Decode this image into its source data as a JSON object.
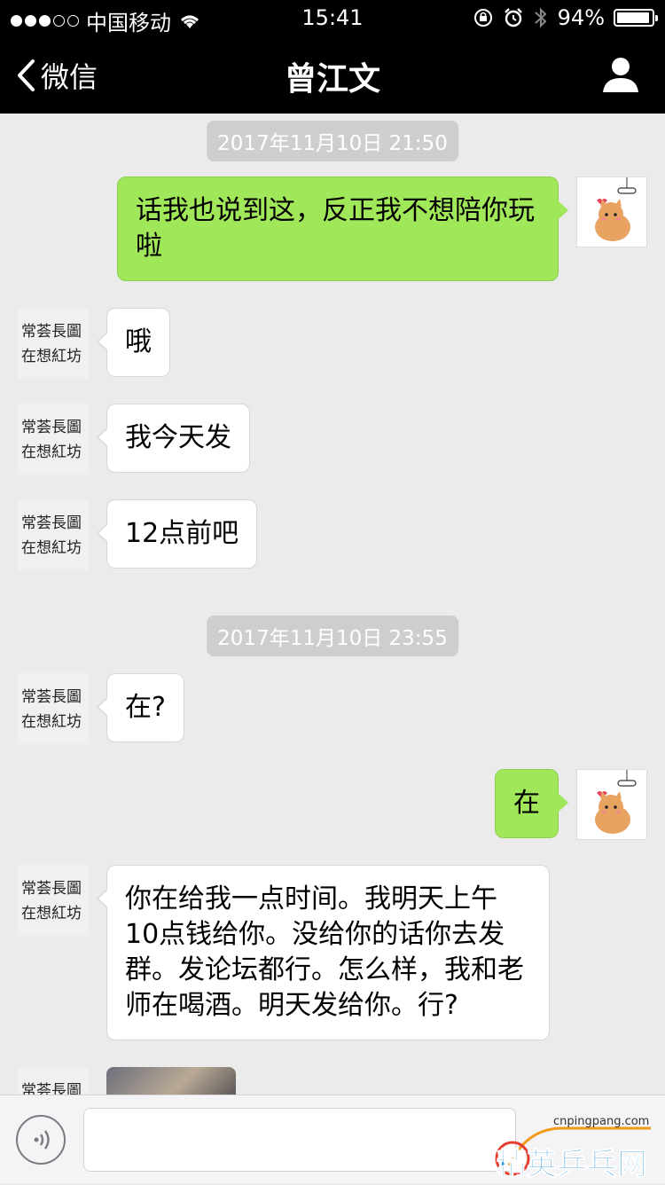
{
  "status_bar": {
    "carrier": "中国移动",
    "time": "15:41",
    "battery": "94%",
    "battery_level": 0.94
  },
  "nav": {
    "back_label": "微信",
    "title": "曾江文"
  },
  "timestamps": [
    "2017年11月10日 21:50",
    "2017年11月10日 23:55"
  ],
  "messages": [
    {
      "text": "话我也说到这，反正我不想陪你玩啦"
    },
    {
      "text": "哦"
    },
    {
      "text": "我今天发"
    },
    {
      "text": "12点前吧"
    },
    {
      "text": "在?"
    },
    {
      "text": "在"
    },
    {
      "text": "你在给我一点时间。我明天上午10点钱给你。没给你的话你去发群。发论坛都行。怎么样，我和老师在喝酒。明天发给你。行?"
    }
  ],
  "avatar_calligraphy": "常荟長圖在想紅坊",
  "watermark": {
    "url": "cnpingpang.com",
    "name": "精英乒乓网"
  },
  "colors": {
    "outgoing_bubble": "#a0e75a",
    "incoming_bubble": "#ffffff",
    "background": "#ebebeb",
    "nav_background": "#000000"
  }
}
